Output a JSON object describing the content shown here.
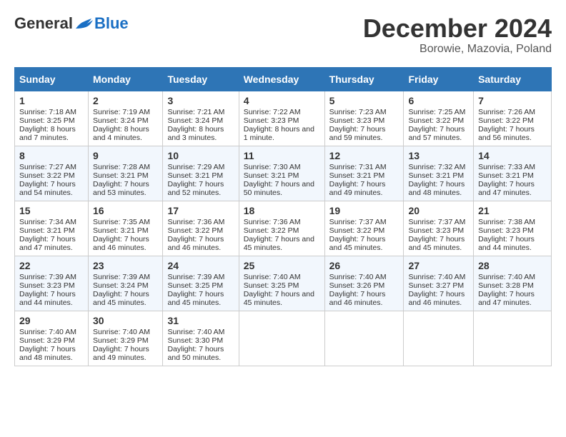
{
  "header": {
    "logo_general": "General",
    "logo_blue": "Blue",
    "month_title": "December 2024",
    "location": "Borowie, Mazovia, Poland"
  },
  "days_of_week": [
    "Sunday",
    "Monday",
    "Tuesday",
    "Wednesday",
    "Thursday",
    "Friday",
    "Saturday"
  ],
  "weeks": [
    [
      {
        "day": "1",
        "sunrise": "Sunrise: 7:18 AM",
        "sunset": "Sunset: 3:25 PM",
        "daylight": "Daylight: 8 hours and 7 minutes."
      },
      {
        "day": "2",
        "sunrise": "Sunrise: 7:19 AM",
        "sunset": "Sunset: 3:24 PM",
        "daylight": "Daylight: 8 hours and 4 minutes."
      },
      {
        "day": "3",
        "sunrise": "Sunrise: 7:21 AM",
        "sunset": "Sunset: 3:24 PM",
        "daylight": "Daylight: 8 hours and 3 minutes."
      },
      {
        "day": "4",
        "sunrise": "Sunrise: 7:22 AM",
        "sunset": "Sunset: 3:23 PM",
        "daylight": "Daylight: 8 hours and 1 minute."
      },
      {
        "day": "5",
        "sunrise": "Sunrise: 7:23 AM",
        "sunset": "Sunset: 3:23 PM",
        "daylight": "Daylight: 7 hours and 59 minutes."
      },
      {
        "day": "6",
        "sunrise": "Sunrise: 7:25 AM",
        "sunset": "Sunset: 3:22 PM",
        "daylight": "Daylight: 7 hours and 57 minutes."
      },
      {
        "day": "7",
        "sunrise": "Sunrise: 7:26 AM",
        "sunset": "Sunset: 3:22 PM",
        "daylight": "Daylight: 7 hours and 56 minutes."
      }
    ],
    [
      {
        "day": "8",
        "sunrise": "Sunrise: 7:27 AM",
        "sunset": "Sunset: 3:22 PM",
        "daylight": "Daylight: 7 hours and 54 minutes."
      },
      {
        "day": "9",
        "sunrise": "Sunrise: 7:28 AM",
        "sunset": "Sunset: 3:21 PM",
        "daylight": "Daylight: 7 hours and 53 minutes."
      },
      {
        "day": "10",
        "sunrise": "Sunrise: 7:29 AM",
        "sunset": "Sunset: 3:21 PM",
        "daylight": "Daylight: 7 hours and 52 minutes."
      },
      {
        "day": "11",
        "sunrise": "Sunrise: 7:30 AM",
        "sunset": "Sunset: 3:21 PM",
        "daylight": "Daylight: 7 hours and 50 minutes."
      },
      {
        "day": "12",
        "sunrise": "Sunrise: 7:31 AM",
        "sunset": "Sunset: 3:21 PM",
        "daylight": "Daylight: 7 hours and 49 minutes."
      },
      {
        "day": "13",
        "sunrise": "Sunrise: 7:32 AM",
        "sunset": "Sunset: 3:21 PM",
        "daylight": "Daylight: 7 hours and 48 minutes."
      },
      {
        "day": "14",
        "sunrise": "Sunrise: 7:33 AM",
        "sunset": "Sunset: 3:21 PM",
        "daylight": "Daylight: 7 hours and 47 minutes."
      }
    ],
    [
      {
        "day": "15",
        "sunrise": "Sunrise: 7:34 AM",
        "sunset": "Sunset: 3:21 PM",
        "daylight": "Daylight: 7 hours and 47 minutes."
      },
      {
        "day": "16",
        "sunrise": "Sunrise: 7:35 AM",
        "sunset": "Sunset: 3:21 PM",
        "daylight": "Daylight: 7 hours and 46 minutes."
      },
      {
        "day": "17",
        "sunrise": "Sunrise: 7:36 AM",
        "sunset": "Sunset: 3:22 PM",
        "daylight": "Daylight: 7 hours and 46 minutes."
      },
      {
        "day": "18",
        "sunrise": "Sunrise: 7:36 AM",
        "sunset": "Sunset: 3:22 PM",
        "daylight": "Daylight: 7 hours and 45 minutes."
      },
      {
        "day": "19",
        "sunrise": "Sunrise: 7:37 AM",
        "sunset": "Sunset: 3:22 PM",
        "daylight": "Daylight: 7 hours and 45 minutes."
      },
      {
        "day": "20",
        "sunrise": "Sunrise: 7:37 AM",
        "sunset": "Sunset: 3:23 PM",
        "daylight": "Daylight: 7 hours and 45 minutes."
      },
      {
        "day": "21",
        "sunrise": "Sunrise: 7:38 AM",
        "sunset": "Sunset: 3:23 PM",
        "daylight": "Daylight: 7 hours and 44 minutes."
      }
    ],
    [
      {
        "day": "22",
        "sunrise": "Sunrise: 7:39 AM",
        "sunset": "Sunset: 3:23 PM",
        "daylight": "Daylight: 7 hours and 44 minutes."
      },
      {
        "day": "23",
        "sunrise": "Sunrise: 7:39 AM",
        "sunset": "Sunset: 3:24 PM",
        "daylight": "Daylight: 7 hours and 45 minutes."
      },
      {
        "day": "24",
        "sunrise": "Sunrise: 7:39 AM",
        "sunset": "Sunset: 3:25 PM",
        "daylight": "Daylight: 7 hours and 45 minutes."
      },
      {
        "day": "25",
        "sunrise": "Sunrise: 7:40 AM",
        "sunset": "Sunset: 3:25 PM",
        "daylight": "Daylight: 7 hours and 45 minutes."
      },
      {
        "day": "26",
        "sunrise": "Sunrise: 7:40 AM",
        "sunset": "Sunset: 3:26 PM",
        "daylight": "Daylight: 7 hours and 46 minutes."
      },
      {
        "day": "27",
        "sunrise": "Sunrise: 7:40 AM",
        "sunset": "Sunset: 3:27 PM",
        "daylight": "Daylight: 7 hours and 46 minutes."
      },
      {
        "day": "28",
        "sunrise": "Sunrise: 7:40 AM",
        "sunset": "Sunset: 3:28 PM",
        "daylight": "Daylight: 7 hours and 47 minutes."
      }
    ],
    [
      {
        "day": "29",
        "sunrise": "Sunrise: 7:40 AM",
        "sunset": "Sunset: 3:29 PM",
        "daylight": "Daylight: 7 hours and 48 minutes."
      },
      {
        "day": "30",
        "sunrise": "Sunrise: 7:40 AM",
        "sunset": "Sunset: 3:29 PM",
        "daylight": "Daylight: 7 hours and 49 minutes."
      },
      {
        "day": "31",
        "sunrise": "Sunrise: 7:40 AM",
        "sunset": "Sunset: 3:30 PM",
        "daylight": "Daylight: 7 hours and 50 minutes."
      },
      null,
      null,
      null,
      null
    ]
  ]
}
